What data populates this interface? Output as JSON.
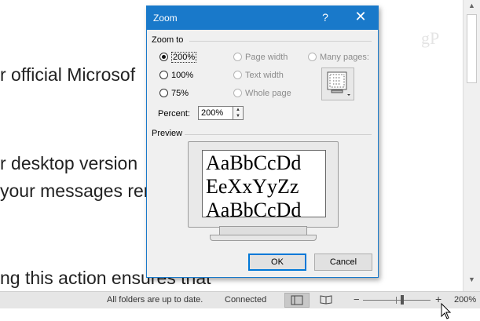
{
  "document": {
    "lines": [
      "r official Microsof",
      "r desktop version",
      "your messages ren",
      "ng this action ensures that"
    ],
    "watermark": "gP"
  },
  "status_bar": {
    "sync_status": "All folders are up to date.",
    "connection": "Connected",
    "zoom_level": "200%",
    "zoom_minus": "−",
    "zoom_plus": "+"
  },
  "zoom_dialog": {
    "title": "Zoom",
    "help": "?",
    "close": "✕",
    "zoom_to_label": "Zoom to",
    "options": {
      "p200": "200%",
      "p100": "100%",
      "p75": "75%",
      "page_width": "Page width",
      "text_width": "Text width",
      "whole_page": "Whole page",
      "many_pages": "Many pages:"
    },
    "selected_option": "200%",
    "percent_label": "Percent:",
    "percent_value": "200%",
    "preview_label": "Preview",
    "preview_text": [
      "AaBbCcDd",
      "EeXxYyZz",
      "AaBbCcDd"
    ],
    "ok_label": "OK",
    "cancel_label": "Cancel"
  },
  "colors": {
    "titlebar": "#1979ca",
    "dialog_bg": "#f0f0f0",
    "status_bar_bg": "#e6e6e6"
  }
}
